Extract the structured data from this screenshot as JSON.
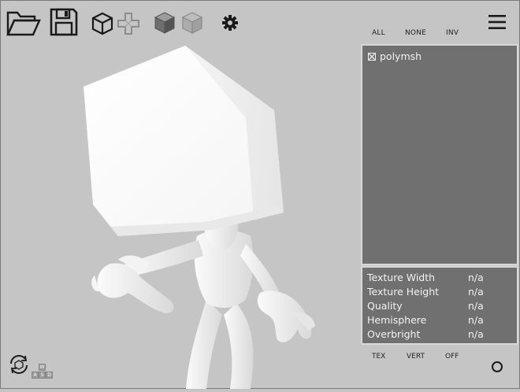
{
  "toolbar": {
    "icons": [
      "open-folder-icon",
      "save-icon",
      "wireframe-cube-icon",
      "move-cross-icon",
      "solid-cube-icon",
      "transparent-cube-icon",
      "gear-icon",
      "hamburger-menu-icon"
    ]
  },
  "selection": {
    "all_label": "ALL",
    "none_label": "NONE",
    "inv_label": "INV"
  },
  "mesh_list": {
    "items": [
      {
        "label": "polymsh",
        "checked": true
      }
    ]
  },
  "info": {
    "rows": [
      {
        "label": "Texture Width",
        "value": "n/a"
      },
      {
        "label": "Texture Height",
        "value": "n/a"
      },
      {
        "label": "Quality",
        "value": "n/a"
      },
      {
        "label": "Hemisphere",
        "value": "n/a"
      },
      {
        "label": "Overbright",
        "value": "n/a"
      }
    ]
  },
  "modes": {
    "tex_label": "TEX",
    "vert_label": "VERT",
    "off_label": "OFF"
  },
  "wasd": {
    "w": "W",
    "a": "A",
    "s": "S",
    "d": "D"
  },
  "colors": {
    "background": "#c5c5c5",
    "panel": "#707070",
    "panel_border": "#d8d8d8"
  }
}
